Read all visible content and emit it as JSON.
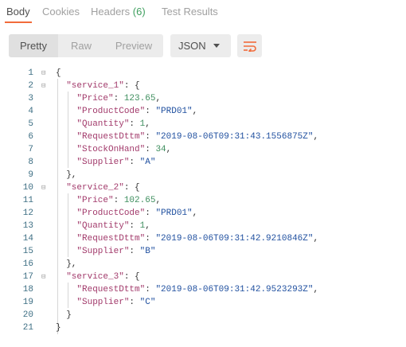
{
  "tabs": {
    "body": "Body",
    "cookies": "Cookies",
    "headers": "Headers",
    "headers_count": "(6)",
    "test_results": "Test Results"
  },
  "toolbar": {
    "pretty": "Pretty",
    "raw": "Raw",
    "preview": "Preview",
    "format": "JSON"
  },
  "colors": {
    "accent": "#f26b3a",
    "key": "#a23a6b",
    "string": "#1f4f9f",
    "number": "#3f8f5f",
    "line_number": "#3e6f84"
  },
  "icons": {
    "wrap": "wrap-lines-icon",
    "caret": "chevron-down-icon",
    "fold": "fold-toggle-icon"
  },
  "code": {
    "line_numbers": [
      "1",
      "2",
      "3",
      "4",
      "5",
      "6",
      "7",
      "8",
      "9",
      "10",
      "11",
      "12",
      "13",
      "14",
      "15",
      "16",
      "17",
      "18",
      "19",
      "20",
      "21"
    ],
    "lines": [
      [
        {
          "t": "p",
          "v": "{"
        }
      ],
      [
        {
          "t": "p",
          "v": "  "
        },
        {
          "t": "key",
          "v": "\"service_1\""
        },
        {
          "t": "p",
          "v": ": {"
        }
      ],
      [
        {
          "t": "p",
          "v": "    "
        },
        {
          "t": "key",
          "v": "\"Price\""
        },
        {
          "t": "p",
          "v": ": "
        },
        {
          "t": "num",
          "v": "123.65"
        },
        {
          "t": "p",
          "v": ","
        }
      ],
      [
        {
          "t": "p",
          "v": "    "
        },
        {
          "t": "key",
          "v": "\"ProductCode\""
        },
        {
          "t": "p",
          "v": ": "
        },
        {
          "t": "str",
          "v": "\"PRD01\""
        },
        {
          "t": "p",
          "v": ","
        }
      ],
      [
        {
          "t": "p",
          "v": "    "
        },
        {
          "t": "key",
          "v": "\"Quantity\""
        },
        {
          "t": "p",
          "v": ": "
        },
        {
          "t": "num",
          "v": "1"
        },
        {
          "t": "p",
          "v": ","
        }
      ],
      [
        {
          "t": "p",
          "v": "    "
        },
        {
          "t": "key",
          "v": "\"RequestDttm\""
        },
        {
          "t": "p",
          "v": ": "
        },
        {
          "t": "str",
          "v": "\"2019-08-06T09:31:43.1556875Z\""
        },
        {
          "t": "p",
          "v": ","
        }
      ],
      [
        {
          "t": "p",
          "v": "    "
        },
        {
          "t": "key",
          "v": "\"StockOnHand\""
        },
        {
          "t": "p",
          "v": ": "
        },
        {
          "t": "num",
          "v": "34"
        },
        {
          "t": "p",
          "v": ","
        }
      ],
      [
        {
          "t": "p",
          "v": "    "
        },
        {
          "t": "key",
          "v": "\"Supplier\""
        },
        {
          "t": "p",
          "v": ": "
        },
        {
          "t": "str",
          "v": "\"A\""
        }
      ],
      [
        {
          "t": "p",
          "v": "  },"
        }
      ],
      [
        {
          "t": "p",
          "v": "  "
        },
        {
          "t": "key",
          "v": "\"service_2\""
        },
        {
          "t": "p",
          "v": ": {"
        }
      ],
      [
        {
          "t": "p",
          "v": "    "
        },
        {
          "t": "key",
          "v": "\"Price\""
        },
        {
          "t": "p",
          "v": ": "
        },
        {
          "t": "num",
          "v": "102.65"
        },
        {
          "t": "p",
          "v": ","
        }
      ],
      [
        {
          "t": "p",
          "v": "    "
        },
        {
          "t": "key",
          "v": "\"ProductCode\""
        },
        {
          "t": "p",
          "v": ": "
        },
        {
          "t": "str",
          "v": "\"PRD01\""
        },
        {
          "t": "p",
          "v": ","
        }
      ],
      [
        {
          "t": "p",
          "v": "    "
        },
        {
          "t": "key",
          "v": "\"Quantity\""
        },
        {
          "t": "p",
          "v": ": "
        },
        {
          "t": "num",
          "v": "1"
        },
        {
          "t": "p",
          "v": ","
        }
      ],
      [
        {
          "t": "p",
          "v": "    "
        },
        {
          "t": "key",
          "v": "\"RequestDttm\""
        },
        {
          "t": "p",
          "v": ": "
        },
        {
          "t": "str",
          "v": "\"2019-08-06T09:31:42.9210846Z\""
        },
        {
          "t": "p",
          "v": ","
        }
      ],
      [
        {
          "t": "p",
          "v": "    "
        },
        {
          "t": "key",
          "v": "\"Supplier\""
        },
        {
          "t": "p",
          "v": ": "
        },
        {
          "t": "str",
          "v": "\"B\""
        }
      ],
      [
        {
          "t": "p",
          "v": "  },"
        }
      ],
      [
        {
          "t": "p",
          "v": "  "
        },
        {
          "t": "key",
          "v": "\"service_3\""
        },
        {
          "t": "p",
          "v": ": {"
        }
      ],
      [
        {
          "t": "p",
          "v": "    "
        },
        {
          "t": "key",
          "v": "\"RequestDttm\""
        },
        {
          "t": "p",
          "v": ": "
        },
        {
          "t": "str",
          "v": "\"2019-08-06T09:31:42.9523293Z\""
        },
        {
          "t": "p",
          "v": ","
        }
      ],
      [
        {
          "t": "p",
          "v": "    "
        },
        {
          "t": "key",
          "v": "\"Supplier\""
        },
        {
          "t": "p",
          "v": ": "
        },
        {
          "t": "str",
          "v": "\"C\""
        }
      ],
      [
        {
          "t": "p",
          "v": "  }"
        }
      ],
      [
        {
          "t": "p",
          "v": "}"
        }
      ]
    ],
    "foldable_lines": [
      1,
      2,
      10,
      17
    ]
  }
}
